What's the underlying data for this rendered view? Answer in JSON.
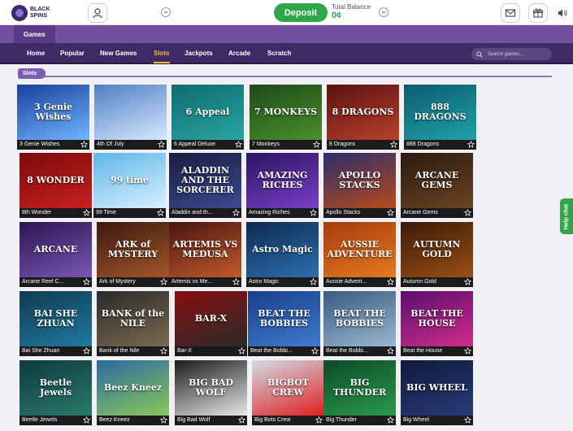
{
  "header": {
    "logo_text": "BLACK SPINS",
    "deposit_label": "Deposit",
    "balance_label": "Total Balance",
    "balance_value": "0¢"
  },
  "games_tab": "Games",
  "nav": [
    {
      "label": "Home",
      "active": false
    },
    {
      "label": "Popular",
      "active": false
    },
    {
      "label": "New Games",
      "active": false
    },
    {
      "label": "Slots",
      "active": true
    },
    {
      "label": "Jackpots",
      "active": false
    },
    {
      "label": "Arcade",
      "active": false
    },
    {
      "label": "Scratch",
      "active": false
    }
  ],
  "search_placeholder": "Search games...",
  "section_label": "Slots",
  "help_label": "Help chat",
  "games": [
    {
      "caption": "3 Genie Wishes",
      "art": "3 Genie Wishes",
      "colors": [
        "#1b3f9a",
        "#6fb6ff"
      ]
    },
    {
      "caption": "4th Of July",
      "art": "",
      "colors": [
        "#4f7fc4",
        "#d8e9ff"
      ]
    },
    {
      "caption": "6 Appeal Deluxe",
      "art": "6 Appeal",
      "colors": [
        "#0e6b70",
        "#29a5a0"
      ]
    },
    {
      "caption": "7 Monkeys",
      "art": "7 MONKEYS",
      "colors": [
        "#1e4a1a",
        "#4b8f2a"
      ]
    },
    {
      "caption": "8 Dragons",
      "art": "8 DRAGONS",
      "colors": [
        "#5a1212",
        "#b8402a"
      ]
    },
    {
      "caption": "888 Dragons",
      "art": "888 DRAGONS",
      "colors": [
        "#0e5b6e",
        "#1ea2a8"
      ]
    },
    {
      "caption": "8th Wonder",
      "art": "8 WONDER",
      "colors": [
        "#7a0b0b",
        "#c91f1f"
      ]
    },
    {
      "caption": "99 Time",
      "art": "99 time",
      "colors": [
        "#5fb6e8",
        "#d8f1ff"
      ]
    },
    {
      "caption": "Aladdin and th...",
      "art": "ALADDIN AND THE SORCERER",
      "colors": [
        "#1a1c40",
        "#3c4a8f"
      ]
    },
    {
      "caption": "Amazing Riches",
      "art": "AMAZING RICHES",
      "colors": [
        "#2a1560",
        "#7a3dc7"
      ]
    },
    {
      "caption": "Apollo Stacks",
      "art": "APOLLO STACKS",
      "colors": [
        "#2a2d6e",
        "#b84a1a"
      ]
    },
    {
      "caption": "Arcane Gems",
      "art": "ARCANE GEMS",
      "colors": [
        "#2a1a10",
        "#6b4422"
      ]
    },
    {
      "caption": "Arcane Reel C...",
      "art": "ARCANE",
      "colors": [
        "#2c1650",
        "#7a55b8"
      ]
    },
    {
      "caption": "Ark of Mystery",
      "art": "ARK of MYSTERY",
      "colors": [
        "#3a1a0e",
        "#a4552a"
      ]
    },
    {
      "caption": "Artemis vs Me...",
      "art": "ARTEMIS VS MEDUSA",
      "colors": [
        "#4a1410",
        "#c25a2c"
      ]
    },
    {
      "caption": "Astro Magic",
      "art": "Astro Magic",
      "colors": [
        "#0e2a50",
        "#2c6fb0"
      ]
    },
    {
      "caption": "Aussie Advent...",
      "art": "AUSSIE ADVENTURE",
      "colors": [
        "#a83a0e",
        "#e57a1e"
      ]
    },
    {
      "caption": "Autumn Gold",
      "art": "AUTUMN GOLD",
      "colors": [
        "#3a1a08",
        "#9a4f14"
      ]
    },
    {
      "caption": "Bai She Zhuan",
      "art": "BAI SHE ZHUAN",
      "colors": [
        "#123a50",
        "#1e7aa0"
      ]
    },
    {
      "caption": "Bank of the Nile",
      "art": "BANK of the NILE",
      "colors": [
        "#2a2a2a",
        "#7a6a50"
      ]
    },
    {
      "caption": "Bar-X",
      "art": "BAR-X",
      "colors": [
        "#8a0e0e",
        "#2a2a2a"
      ]
    },
    {
      "caption": "Beat the Bobbi...",
      "art": "BEAT THE BOBBIES",
      "colors": [
        "#1a3f8a",
        "#3f7ad0"
      ]
    },
    {
      "caption": "Beat the Bobbi...",
      "art": "BEAT THE BOBBIES",
      "colors": [
        "#3a5a80",
        "#9ab8d0"
      ]
    },
    {
      "caption": "Beat the House",
      "art": "BEAT THE HOUSE",
      "colors": [
        "#5a0e6e",
        "#d02c8a"
      ]
    },
    {
      "caption": "Beetle Jewels",
      "art": "Beetle Jewels",
      "colors": [
        "#0e3a40",
        "#2a7a6a"
      ]
    },
    {
      "caption": "Beez Kneez",
      "art": "Beez Kneez",
      "colors": [
        "#2a6aa0",
        "#8ac85a"
      ]
    },
    {
      "caption": "Big Bad Wolf",
      "art": "BIG BAD WOLF",
      "colors": [
        "#1a1a1a",
        "#e8e8e8"
      ]
    },
    {
      "caption": "Big Bots Crew",
      "art": "BIGBOT CREW",
      "colors": [
        "#d0dde8",
        "#e02020"
      ]
    },
    {
      "caption": "Big Thunder",
      "art": "BIG THUNDER",
      "colors": [
        "#0e4a2a",
        "#2a9a4a"
      ]
    },
    {
      "caption": "Big Wheel",
      "art": "BIG WHEEL",
      "colors": [
        "#0e1a3a",
        "#2a3a7a"
      ]
    }
  ]
}
